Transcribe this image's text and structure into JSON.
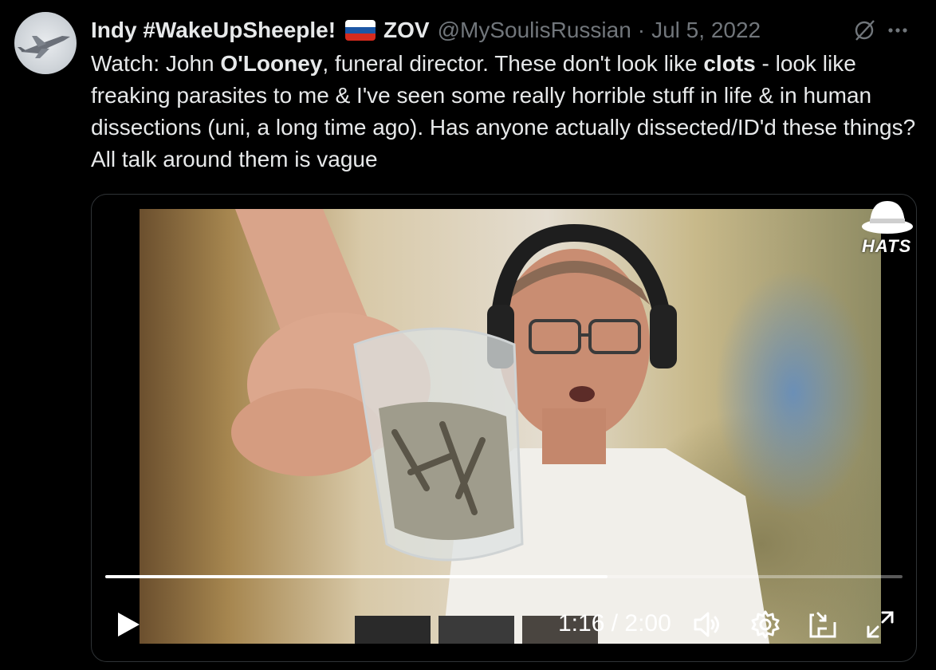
{
  "author": {
    "display_name": "Indy #WakeUpSheeple!",
    "flag_emoji": "russian-flag",
    "tag": "ZOV",
    "handle": "@MySoulisRussian",
    "separator": "·",
    "date": "Jul 5, 2022"
  },
  "tweet": {
    "text_parts": [
      {
        "t": "Watch: John ",
        "bold": false
      },
      {
        "t": "O'Looney",
        "bold": true
      },
      {
        "t": ", funeral director. These don't look like ",
        "bold": false
      },
      {
        "t": "clots",
        "bold": true
      },
      {
        "t": " - look like freaking parasites to me & I've seen some really horrible stuff in life & in human dissections (uni, a long time ago). Has anyone actually dissected/ID'd these things? All talk around them is vague",
        "bold": false
      }
    ]
  },
  "header_icons": [
    "grok-icon",
    "more-options-icon"
  ],
  "video": {
    "current_time": "1:16",
    "duration": "2:00",
    "time_display": "1:16 / 2:00",
    "progress_fraction": 0.63,
    "watermark": "HATS",
    "controls": [
      "play-icon",
      "volume-icon",
      "settings-icon",
      "pop-out-icon",
      "fullscreen-icon"
    ]
  },
  "colors": {
    "background": "#000000",
    "text_primary": "#e7e9ea",
    "text_secondary": "#71767b",
    "flag_white": "#ffffff",
    "flag_blue": "#1c57a5",
    "flag_red": "#d52b1e"
  }
}
